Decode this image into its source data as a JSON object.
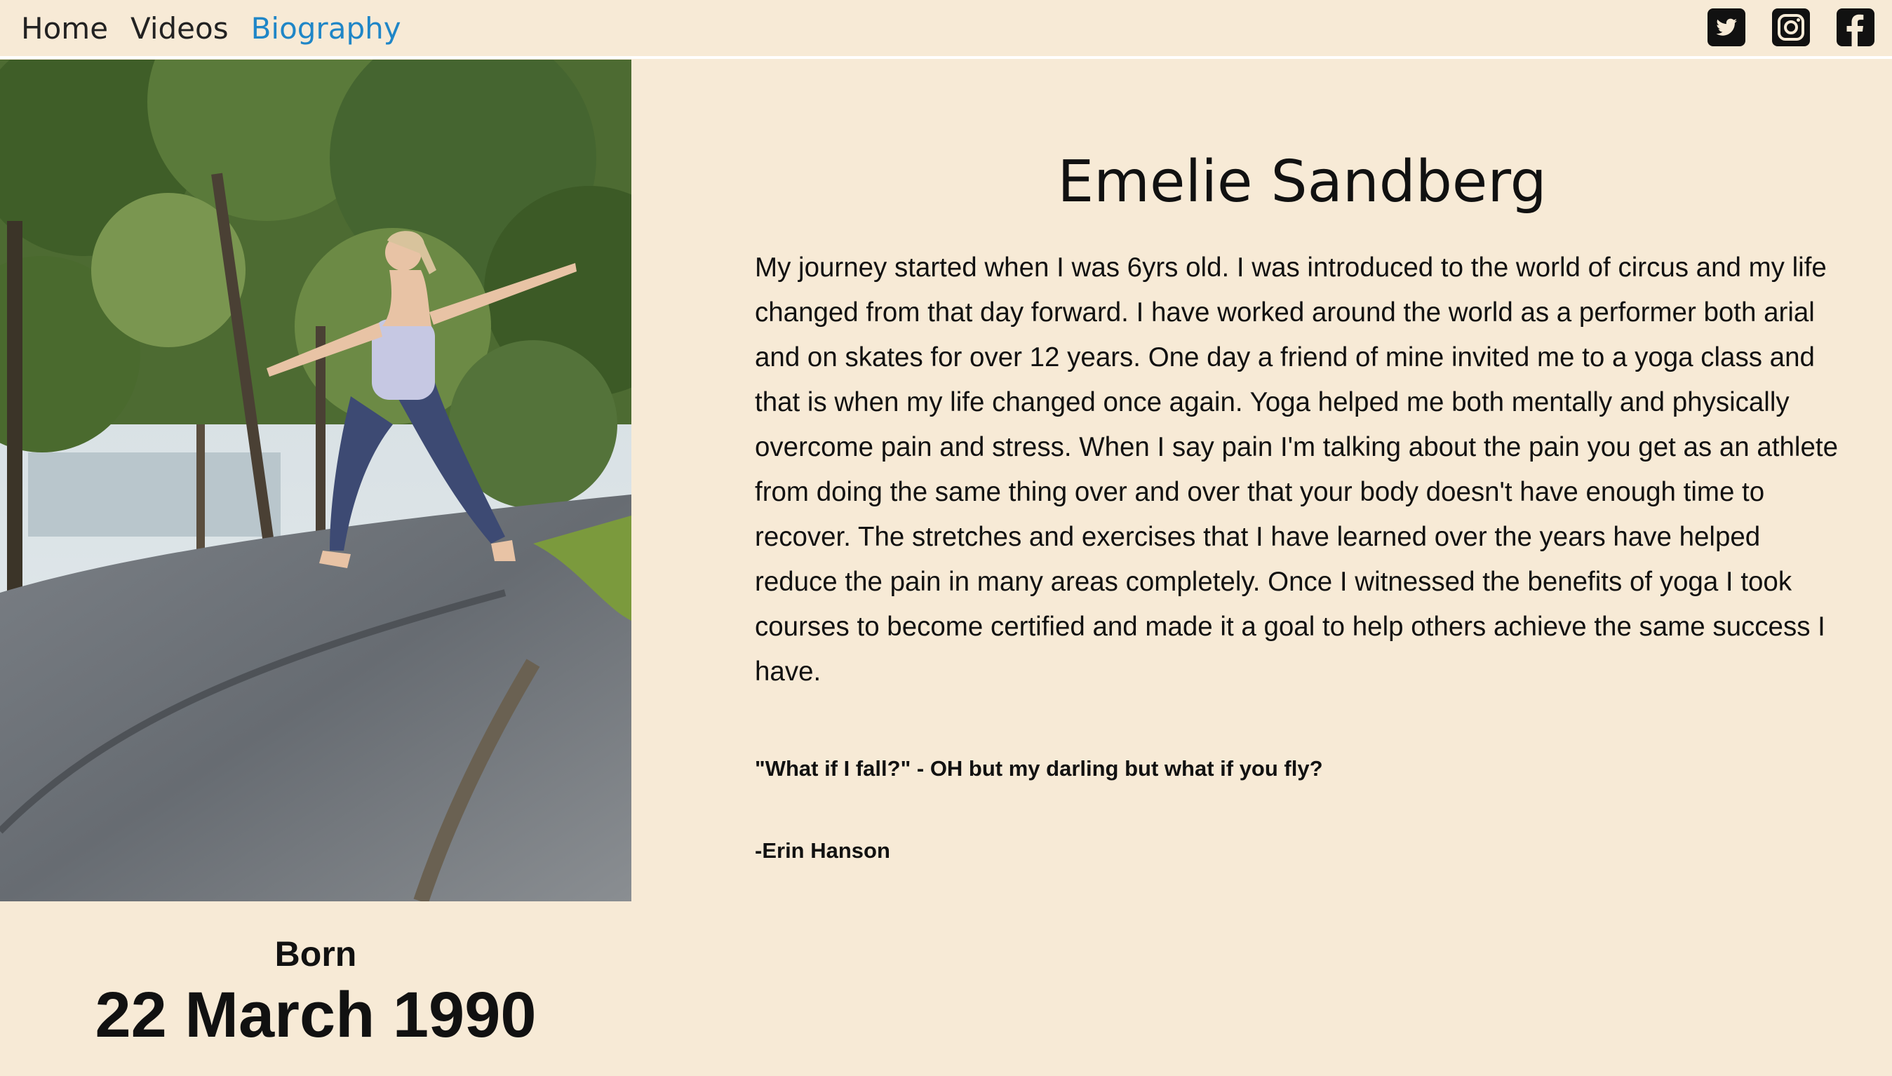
{
  "nav": {
    "items": [
      {
        "label": "Home",
        "active": false
      },
      {
        "label": "Videos",
        "active": false
      },
      {
        "label": "Biography",
        "active": true
      }
    ]
  },
  "social": [
    "twitter-icon",
    "instagram-icon",
    "facebook-icon"
  ],
  "colors": {
    "background": "#f7ead6",
    "active_link": "#1f86c7",
    "text": "#111111"
  },
  "photo": {
    "subject": "woman in warrior yoga pose on granite rock among trees"
  },
  "born": {
    "label": "Born",
    "date": "22 March 1990"
  },
  "bio": {
    "name": "Emelie Sandberg",
    "text": "My journey started when I was 6yrs old. I was introduced to the world of circus and my life changed from that day forward. I have worked around the world as a performer both arial and on skates for over 12 years. One day a friend of mine invited me to a yoga class and that is when my life changed once again. Yoga helped me both mentally and physically overcome pain and stress. When I say pain I'm talking about the pain you get as an athlete from doing the same thing over and over that your body doesn't have enough time to recover. The stretches and exercises that I have learned over the years have helped reduce the pain in many areas completely. Once I witnessed the benefits of yoga I took courses to become certified and made it a goal to help others achieve the same success I have.",
    "quote": "\"What if I fall?\" - OH but my darling but what if you fly?",
    "author": "-Erin Hanson"
  }
}
